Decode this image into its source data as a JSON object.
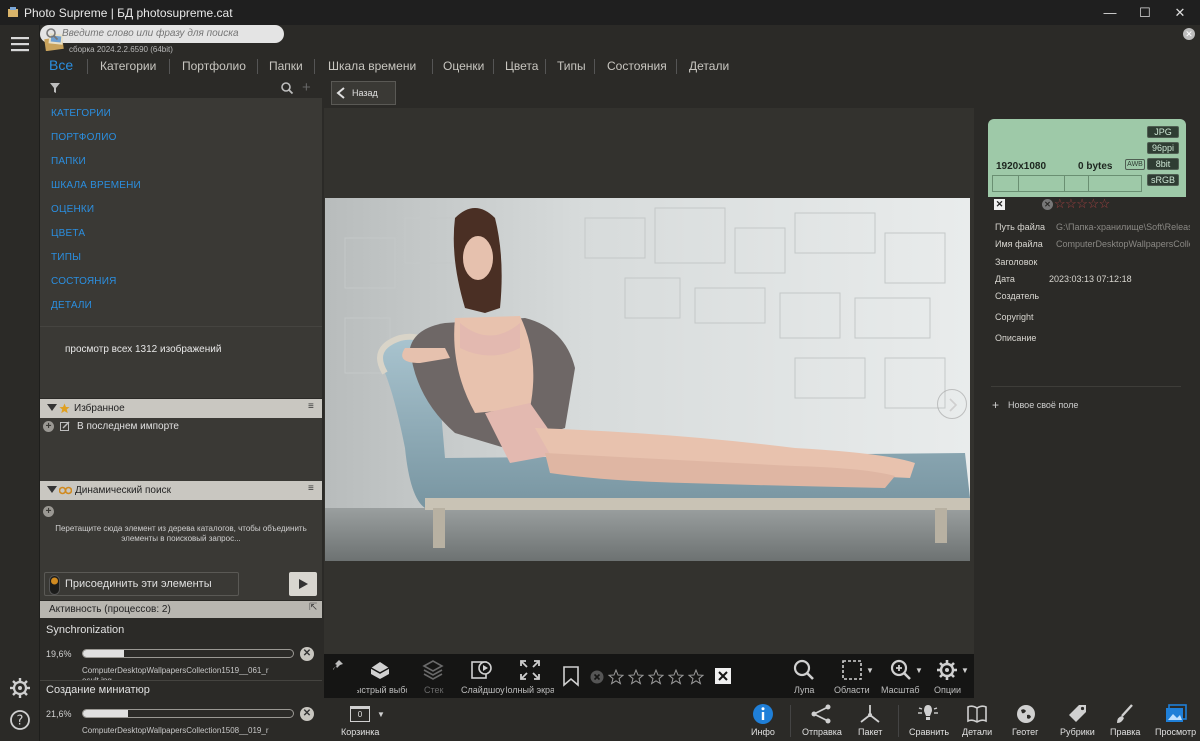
{
  "window": {
    "title": "Photo Supreme | БД photosupreme.cat",
    "minimize_icon": "minimize-icon",
    "maximize_icon": "maximize-icon",
    "close_icon": "close-icon"
  },
  "app": {
    "name": "Photo Supreme",
    "build": "сборка 2024.2.2.6590 (64bit)"
  },
  "tabs": [
    {
      "label": "Все",
      "active": true
    },
    {
      "label": "Категории"
    },
    {
      "label": "Портфолио"
    },
    {
      "label": "Папки"
    },
    {
      "label": "Шкала времени"
    },
    {
      "label": "Оценки"
    },
    {
      "label": "Цвета"
    },
    {
      "label": "Типы"
    },
    {
      "label": "Состояния"
    },
    {
      "label": "Детали"
    }
  ],
  "search": {
    "placeholder": "Введите слово или фразу для поиска",
    "value": ""
  },
  "left_panel": {
    "catalog_items": [
      "КАТЕГОРИИ",
      "ПОРТФОЛИО",
      "ПАПКИ",
      "ШКАЛА ВРЕМЕНИ",
      "ОЦЕНКИ",
      "ЦВЕТА",
      "ТИПЫ",
      "СОСТОЯНИЯ",
      "ДЕТАЛИ"
    ],
    "view_all": "просмотр всех 1312 изображений",
    "favorites": {
      "title": "Избранное",
      "items": [
        "В последнем импорте"
      ]
    },
    "dynamic_search": {
      "title": "Динамический поиск",
      "hint_line1": "Перетащите сюда элемент из дерева каталогов, чтобы объединить",
      "hint_line2": "элементы в поисковый запрос..."
    },
    "merge_button": "Присоединить эти элементы",
    "activity": {
      "title": "Активность (процессов: 2)",
      "processes": [
        {
          "name": "Synchronization",
          "percent_label": "19,6%",
          "fraction": 0.196,
          "file": "ComputerDesktopWallpapersCollection1519__061_r",
          "file2": "esult.jpg"
        },
        {
          "name": "Создание миниатюр",
          "percent_label": "21,6%",
          "fraction": 0.216,
          "file": "ComputerDesktopWallpapersCollection1508__019_r",
          "file2": ""
        }
      ]
    }
  },
  "center": {
    "back_button": "Назад",
    "toolbar": {
      "quick_select": "Быстрый выбор",
      "stack": "Стек",
      "slideshow": "Слайдшоу",
      "fullscreen": "Полный экран",
      "rating": 0,
      "magnifier": "Лупа",
      "regions": "Области",
      "zoom": "Масштаб",
      "options": "Опции"
    }
  },
  "image_info": {
    "resolution": "1920x1080",
    "size": "0 bytes",
    "format": "JPG",
    "dpi": "96ppi",
    "wb": "AWB",
    "bit_depth": "8bit",
    "color_space": "sRGB",
    "rating": 0
  },
  "metadata": {
    "fields": [
      {
        "label": "Путь файла",
        "value": "G:\\Папка-хранилище\\Soft\\Releas"
      },
      {
        "label": "Имя файла",
        "value": "ComputerDesktopWallpapersCollec"
      },
      {
        "label": "Заголовок",
        "value": ""
      },
      {
        "label": "Дата",
        "value": "2023:03:13 07:12:18"
      },
      {
        "label": "Создатель",
        "value": ""
      },
      {
        "label": "Copyright",
        "value": ""
      },
      {
        "label": "Описание",
        "value": ""
      }
    ],
    "new_field": "Новое своё поле"
  },
  "bottom_bar": {
    "basket": "Корзинка",
    "basket_count": "0",
    "items": [
      "Инфо",
      "Отправка",
      "Пакет",
      "Сравнить",
      "Детали",
      "Геотег",
      "Рубрики",
      "Правка",
      "Просмотр"
    ]
  },
  "colors": {
    "accent": "#2b8fe0",
    "background": "#2b2a27",
    "panel": "#3a3935",
    "info_card": "#9ec9a8"
  }
}
